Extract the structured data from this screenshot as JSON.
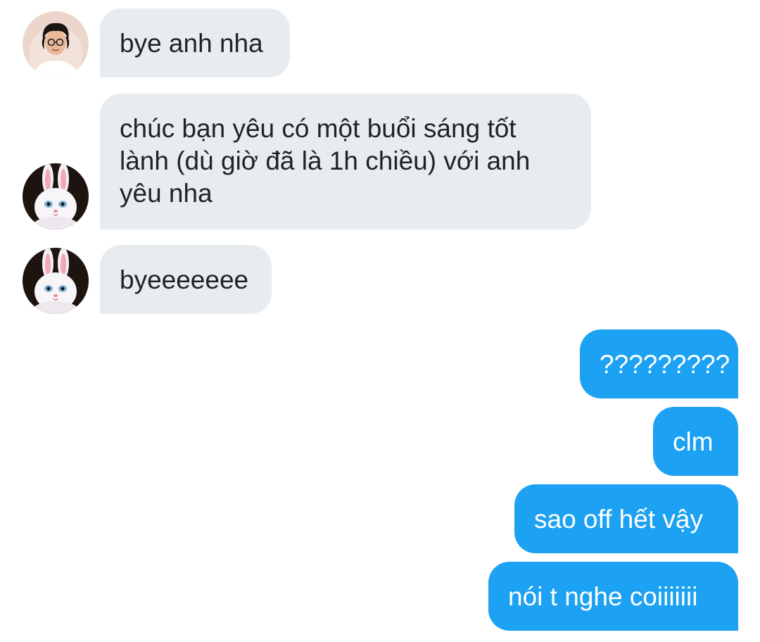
{
  "conversation": {
    "messages": [
      {
        "side": "incoming",
        "avatar": "person-avatar",
        "text": "bye anh nha"
      },
      {
        "side": "incoming",
        "avatar": "bunny-avatar",
        "lines": [
          "chúc bạn yêu có một buổi sáng tốt",
          "lành (dù giờ đã là 1h chiều) với anh",
          "yêu nha"
        ]
      },
      {
        "side": "incoming",
        "avatar": "bunny-avatar",
        "text": "byeeeeeee"
      },
      {
        "side": "outgoing",
        "text": "?????????"
      },
      {
        "side": "outgoing",
        "text": "clm"
      },
      {
        "side": "outgoing",
        "text": "sao off hết vậy"
      },
      {
        "side": "outgoing",
        "text": "nói t nghe coiiiiiii"
      }
    ]
  },
  "colors": {
    "incoming_bubble": "#e6ecf0",
    "outgoing_bubble": "#1da1f2",
    "incoming_text": "#1f2328",
    "outgoing_text": "#ffffff"
  }
}
